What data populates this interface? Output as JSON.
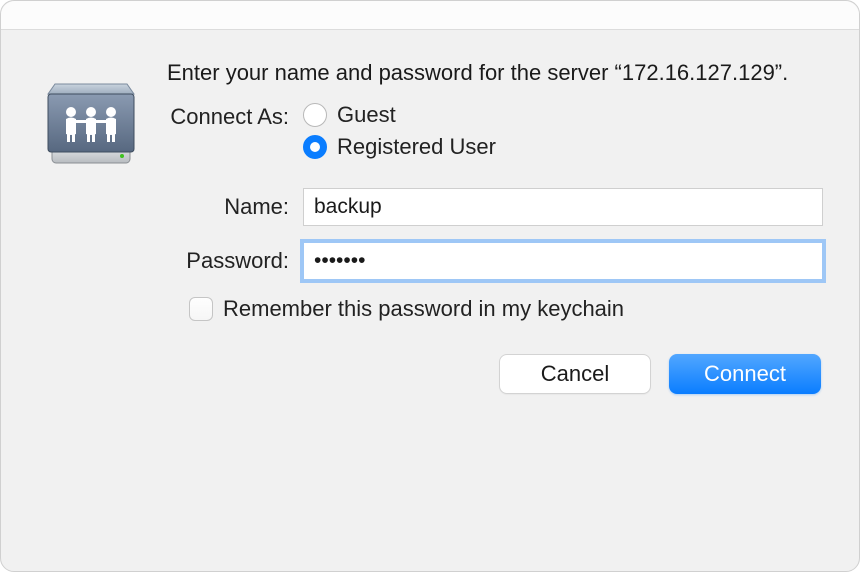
{
  "prompt": "Enter your name and password for the server “172.16.127.129”.",
  "connect_as_label": "Connect As:",
  "radio": {
    "guest": "Guest",
    "registered": "Registered User",
    "selected": "registered"
  },
  "fields": {
    "name_label": "Name:",
    "name_value": "backup",
    "password_label": "Password:",
    "password_value": "•••••••"
  },
  "checkbox": {
    "remember_label": "Remember this password in my keychain",
    "checked": false
  },
  "buttons": {
    "cancel": "Cancel",
    "connect": "Connect"
  }
}
